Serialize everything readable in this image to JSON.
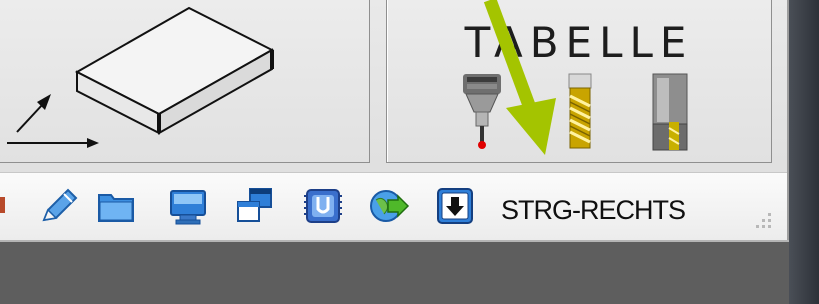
{
  "panel_right": {
    "title": "TABELLE"
  },
  "toolbar": {
    "buttons": [
      {
        "icon": "pencil-icon"
      },
      {
        "icon": "folder-icon"
      },
      {
        "icon": "monitor-icon"
      },
      {
        "icon": "windows-stack-icon"
      },
      {
        "icon": "memory-card-icon"
      },
      {
        "icon": "network-globe-icon"
      },
      {
        "icon": "download-arrow-icon"
      }
    ],
    "status_label": "STRG-RECHTS"
  },
  "colors": {
    "annotation_arrow": "#a4c400",
    "probe_tip": "#e00000",
    "window_bg": "#e4e4e4",
    "dark_bg": "#5e5e5e"
  }
}
